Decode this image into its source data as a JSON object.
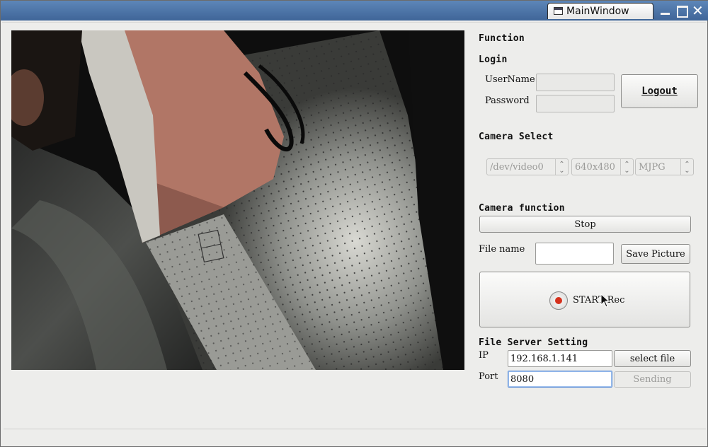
{
  "window": {
    "title": "MainWindow"
  },
  "panel": {
    "function_header": "Function",
    "login": {
      "header": "Login",
      "username_label": "UserName",
      "username_value": "",
      "password_label": "Password",
      "password_value": "",
      "logout_label": "Logout"
    },
    "camera_select": {
      "header": "Camera Select",
      "device": "/dev/video0",
      "resolution": "640x480",
      "format": "MJPG"
    },
    "camera_function": {
      "header": "Camera function",
      "stop_label": "Stop",
      "filename_label": "File name",
      "filename_value": "",
      "save_picture_label": "Save Picture",
      "rec_label": "START Rec"
    },
    "file_server": {
      "header": "File Server Setting",
      "ip_label": "IP",
      "ip_value": "192.168.1.141",
      "select_file_label": "select file",
      "port_label": "Port",
      "port_value": "8080",
      "sending_label": "Sending"
    }
  },
  "colors": {
    "titlebar": "#4a73a8",
    "rec_dot": "#d5301c",
    "focus_border": "#5b8dd6"
  },
  "icons": [
    "window-icon",
    "minimize-icon",
    "maximize-icon",
    "close-icon",
    "record-icon",
    "mouse-cursor-icon"
  ]
}
